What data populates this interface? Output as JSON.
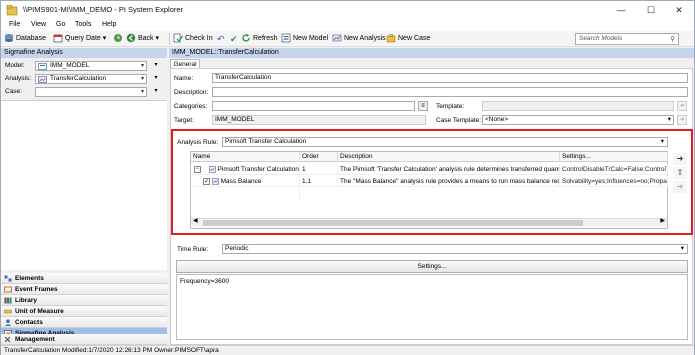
{
  "window": {
    "title": "\\\\PIMS901-MI\\IMM_DEMO - PI System Explorer"
  },
  "menu": [
    "File",
    "View",
    "Go",
    "Tools",
    "Help"
  ],
  "toolbar": {
    "database": "Database",
    "query_date": "Query Date",
    "back": "Back",
    "check_in": "Check In",
    "refresh": "Refresh",
    "new_model": "New Model",
    "new_analysis": "New Analysis",
    "new_case": "New Case",
    "search_placeholder": "Search Models"
  },
  "left_pane": {
    "header": "Sigmafine Analysis",
    "model_label": "Model:",
    "model_value": "IMM_MODEL",
    "analysis_label": "Analysis:",
    "analysis_value": "TransferCalculation",
    "case_label": "Case:",
    "case_value": ""
  },
  "nav": [
    "Elements",
    "Event Frames",
    "Library",
    "Unit of Measure",
    "Contacts",
    "Sigmafine Analysis",
    "Management"
  ],
  "right_pane": {
    "header": "IMM_MODEL::TransferCalculation",
    "tab": "General",
    "name_label": "Name:",
    "name_value": "TransferCalculation",
    "description_label": "Description:",
    "description_value": "",
    "categories_label": "Categories:",
    "template_label": "Template:",
    "target_label": "Target:",
    "target_value": "IMM_MODEL",
    "case_template_label": "Case Template:",
    "case_template_value": "<None>",
    "analysis_rule_label": "Analysis Rule:",
    "analysis_rule_value": "Pimsoft Transfer Calculation",
    "columns": [
      "Name",
      "Order",
      "Description",
      "Settings..."
    ],
    "rows": [
      {
        "name": "Pimsoft Transfer Calculation",
        "order": "1",
        "description": "The Pimsoft 'Transfer Calculation' analysis rule determines transferred quanti...",
        "settings": "ControlDisableTrCalc=False;ControlTank..."
      },
      {
        "name": "Mass Balance",
        "order": "1.1",
        "description": "The \"Mass Balance\" analysis rule provides a means to run mass balance recon...",
        "settings": "Solvability=yes;Influences=no;Propaga..."
      }
    ],
    "time_rule_label": "Time Rule:",
    "time_rule_value": "Periodic",
    "settings_button": "Settings...",
    "time_rule_config": "Frequency=3600"
  },
  "status": "TransferCalculation  Modified:1/7/2020 12:26:13 PM Owner:PIMSOFT\\apra",
  "colors": {
    "highlight": "#e02020",
    "header_bg": "#c6d6ea",
    "nav_active": "#9ec0e8"
  }
}
